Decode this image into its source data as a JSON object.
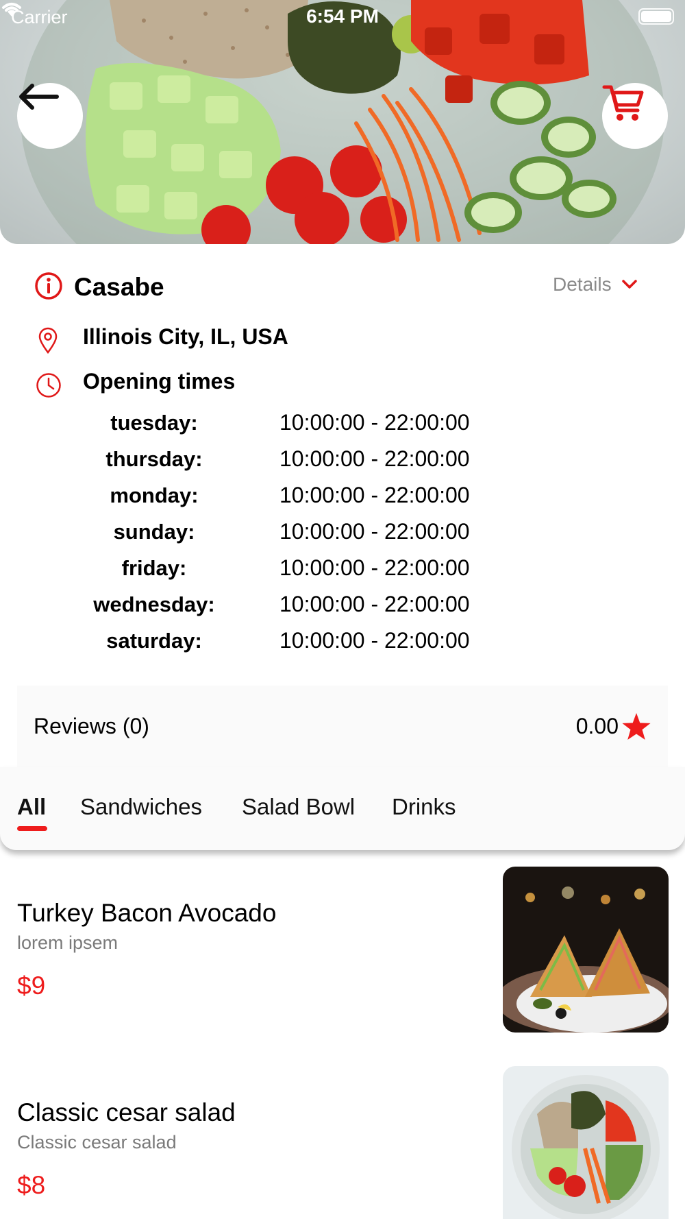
{
  "status_bar": {
    "carrier": "Carrier",
    "time": "6:54 PM"
  },
  "colors": {
    "accent": "#ee1c1c",
    "panel": "#fafafa"
  },
  "header": {
    "back_icon": "arrow-left-icon",
    "cart_icon": "shopping-cart-icon"
  },
  "store": {
    "name": "Casabe",
    "details_label": "Details",
    "address": "Illinois City, IL, USA",
    "opening_title": "Opening times",
    "hours": [
      {
        "day": "tuesday:",
        "time": "10:00:00 - 22:00:00"
      },
      {
        "day": "thursday:",
        "time": "10:00:00 - 22:00:00"
      },
      {
        "day": "monday:",
        "time": "10:00:00 - 22:00:00"
      },
      {
        "day": "sunday:",
        "time": "10:00:00 - 22:00:00"
      },
      {
        "day": "friday:",
        "time": "10:00:00 - 22:00:00"
      },
      {
        "day": "wednesday:",
        "time": "10:00:00 - 22:00:00"
      },
      {
        "day": "saturday:",
        "time": "10:00:00 - 22:00:00"
      }
    ]
  },
  "reviews": {
    "label": "Reviews (0)",
    "rating": "0.00"
  },
  "tabs": [
    {
      "label": "All",
      "active": true
    },
    {
      "label": "Sandwiches"
    },
    {
      "label": "Salad Bowl"
    },
    {
      "label": "Drinks"
    }
  ],
  "menu": [
    {
      "name": "Turkey Bacon Avocado",
      "description": "lorem ipsem",
      "price": "$9"
    },
    {
      "name": "Classic cesar salad",
      "description": "Classic cesar salad",
      "price": "$8"
    }
  ]
}
